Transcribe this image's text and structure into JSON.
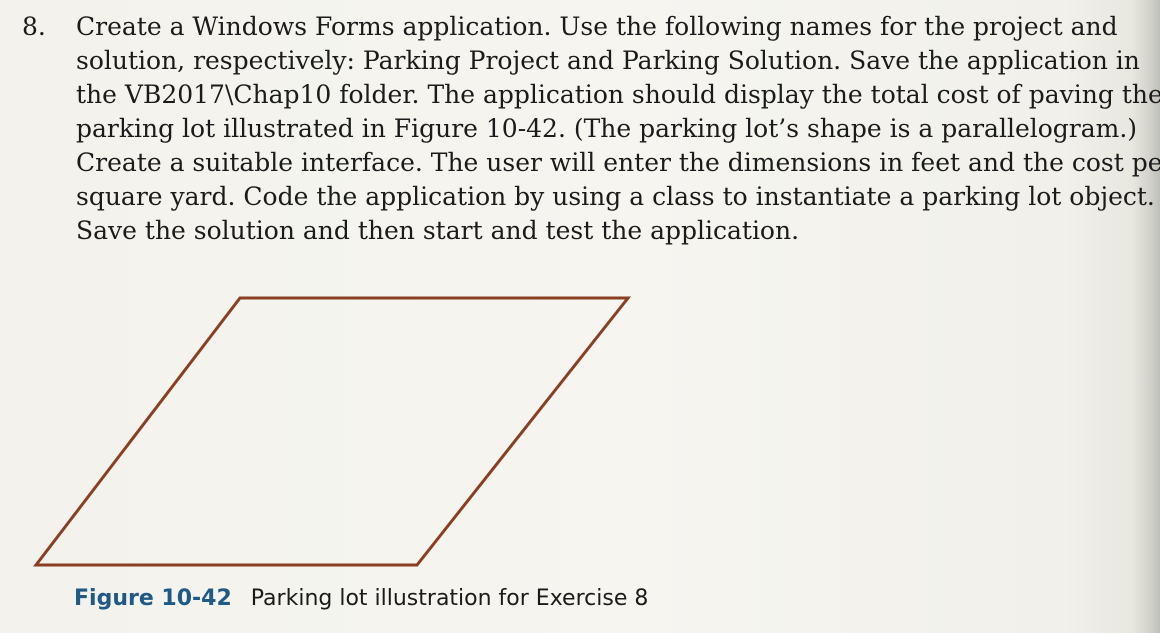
{
  "exercise": {
    "number": "8.",
    "lines": [
      "Create a Windows Forms application. Use the following names for the project and",
      "solution, respectively: Parking Project and Parking Solution. Save the application in",
      "the VB2017\\Chap10 folder. The application should display the total cost of paving the",
      "parking lot illustrated in Figure 10-42. (The parking lot’s shape is a parallelogram.)",
      "Create a suitable interface. The user will enter the dimensions in feet and the cost per",
      "square yard. Code the application by using a class to instantiate a parking lot object.",
      "Save the solution and then start and test the application."
    ]
  },
  "figure": {
    "label": "Figure 10-42",
    "title": "Parking lot illustration for Exercise 8",
    "shape_color": "#8a3f22",
    "label_color": "#1f5a86"
  }
}
